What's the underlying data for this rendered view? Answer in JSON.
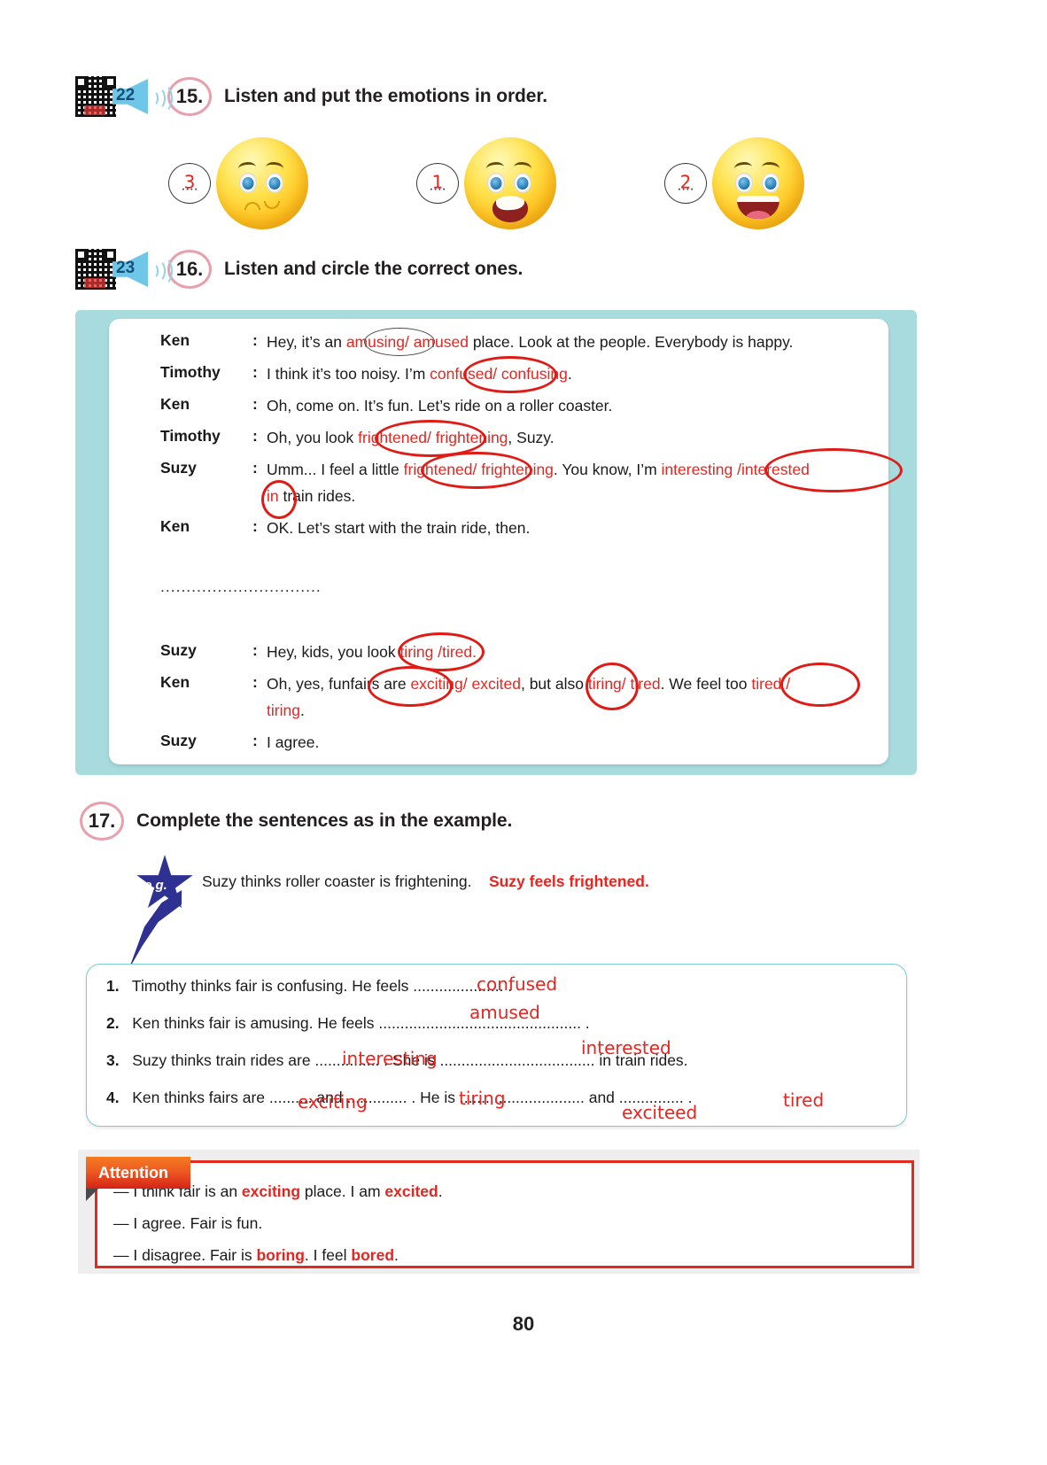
{
  "page": {
    "number": "80"
  },
  "exercise15": {
    "track": "22",
    "number": "15.",
    "title": "Listen and put the emotions in order.",
    "icons": {
      "qr": "qr-code-icon",
      "speaker": "speaker-icon"
    },
    "emojis": [
      {
        "answer": "3",
        "dots": "....",
        "face": "confused-face",
        "order_shown": 1
      },
      {
        "answer": "1",
        "dots": "....",
        "face": "frightened-face",
        "order_shown": 2
      },
      {
        "answer": "2",
        "dots": "....",
        "face": "happy-face",
        "order_shown": 3
      }
    ]
  },
  "exercise16": {
    "track": "23",
    "number": "16.",
    "title": "Listen and circle the correct ones.",
    "separator": "...............................",
    "dialogue": [
      {
        "speaker": "Ken",
        "colon": ":",
        "segments": [
          {
            "text": "Hey, it’s an ",
            "color": "black"
          },
          {
            "text": "amusing",
            "color": "red",
            "circled": true
          },
          {
            "text": "/ amused",
            "color": "red"
          },
          {
            "text": " place. Look at the people. Everybody is happy.",
            "color": "black"
          }
        ]
      },
      {
        "speaker": "Timothy",
        "colon": ":",
        "segments": [
          {
            "text": "I think it’s too noisy. I’m ",
            "color": "black"
          },
          {
            "text": "confused",
            "color": "red",
            "circled": true
          },
          {
            "text": "/ confusing",
            "color": "red"
          },
          {
            "text": ".",
            "color": "black"
          }
        ]
      },
      {
        "speaker": "Ken",
        "colon": ":",
        "segments": [
          {
            "text": "Oh, come on. It’s fun. Let’s ride on a roller coaster.",
            "color": "black"
          }
        ]
      },
      {
        "speaker": "Timothy",
        "colon": ":",
        "segments": [
          {
            "text": "Oh, you look ",
            "color": "black"
          },
          {
            "text": "frightened",
            "color": "red",
            "circled": true
          },
          {
            "text": "/ frightening",
            "color": "red"
          },
          {
            "text": ", Suzy.",
            "color": "black"
          }
        ]
      },
      {
        "speaker": "Suzy",
        "colon": ":",
        "segments": [
          {
            "text": "Umm... I feel a little ",
            "color": "black"
          },
          {
            "text": "frightened",
            "color": "red",
            "circled": true
          },
          {
            "text": "/ frightening",
            "color": "red"
          },
          {
            "text": ". You know, I’m ",
            "color": "black"
          },
          {
            "text": "interesting /",
            "color": "red"
          },
          {
            "text": "interested",
            "color": "red",
            "circled": true
          }
        ],
        "second_line": [
          {
            "text": "in",
            "color": "red",
            "circled": true
          },
          {
            "text": " train rides.",
            "color": "black"
          }
        ]
      },
      {
        "speaker": "Ken",
        "colon": ":",
        "segments": [
          {
            "text": "OK. Let’s start with the train ride, then.",
            "color": "black"
          }
        ]
      },
      {
        "speaker": "Suzy",
        "colon": ":",
        "segments": [
          {
            "text": "Hey, kids, you look ",
            "color": "black"
          },
          {
            "text": "tiring /",
            "color": "red"
          },
          {
            "text": "tired",
            "color": "red",
            "circled": true
          },
          {
            "text": ".",
            "color": "red"
          }
        ]
      },
      {
        "speaker": "Ken",
        "colon": ":",
        "segments": [
          {
            "text": "Oh, yes, funfairs are ",
            "color": "black"
          },
          {
            "text": "exciting",
            "color": "red",
            "circled": true
          },
          {
            "text": "/ excited",
            "color": "red"
          },
          {
            "text": ", but also ",
            "color": "black"
          },
          {
            "text": "tiring",
            "color": "red",
            "circled": true
          },
          {
            "text": "/ tired",
            "color": "red"
          },
          {
            "text": ". We feel too ",
            "color": "black"
          },
          {
            "text": "tired /",
            "color": "red",
            "circled": true
          }
        ],
        "second_line": [
          {
            "text": "tiring",
            "color": "red"
          },
          {
            "text": ".",
            "color": "black"
          }
        ]
      },
      {
        "speaker": "Suzy",
        "colon": ":",
        "segments": [
          {
            "text": "I agree.",
            "color": "black"
          }
        ]
      }
    ]
  },
  "exercise17": {
    "number": "17.",
    "title": "Complete the sentences as in the example.",
    "example": {
      "star_label": "e.g.",
      "prompt": "Suzy thinks roller coaster is frightening.",
      "answer": "Suzy feels frightened."
    },
    "items": [
      {
        "index": "1.",
        "before": "Timothy thinks fair is confusing. He feels ......",
        "handwritten": "confused",
        "after": "............... ."
      },
      {
        "index": "2.",
        "before": "Ken thinks fair is amusing. He feels ...............................................",
        "handwritten": "amused",
        "after": " ."
      },
      {
        "index": "3.",
        "before": "Suzy thinks train rides are ....",
        "handwritten": "interesting",
        "middle": "........... . She is .........................",
        "handwritten2": "interested",
        "after": "........... in train rides."
      },
      {
        "index": "4.",
        "before": "Ken thinks fairs are ....",
        "handwritten": "exciting",
        "middle": "...... and ......",
        "handwritten2": "tiring",
        "middle2": "........ . He is .......................",
        "handwritten3": "exciteed",
        "middle3": "...... and ...",
        "handwritten4": "tired",
        "after": "............ ."
      }
    ]
  },
  "attention": {
    "label": "Attention",
    "lines": [
      {
        "dash": "—",
        "segments": [
          {
            "text": " I think fair is an ",
            "style": "normal"
          },
          {
            "text": "exciting",
            "style": "bold-red"
          },
          {
            "text": " place. I am ",
            "style": "normal"
          },
          {
            "text": "excited",
            "style": "bold-red"
          },
          {
            "text": ".",
            "style": "normal"
          }
        ]
      },
      {
        "dash": "—",
        "segments": [
          {
            "text": " I agree. Fair is fun.",
            "style": "normal"
          }
        ]
      },
      {
        "dash": "—",
        "segments": [
          {
            "text": " I disagree. Fair is ",
            "style": "normal"
          },
          {
            "text": "boring",
            "style": "bold-red"
          },
          {
            "text": ". I feel ",
            "style": "normal"
          },
          {
            "text": "bored",
            "style": "bold-red"
          },
          {
            "text": ".",
            "style": "normal"
          }
        ]
      }
    ]
  },
  "colors": {
    "accent_red": "#e8241f",
    "panel_teal": "#a8dbdd",
    "exercise_circle": "#e8a0ad",
    "attention_orange": "#ef5a21",
    "attention_border": "#e02b20",
    "speaker_blue": "#6ec6e8",
    "star_blue": "#2e3192"
  }
}
